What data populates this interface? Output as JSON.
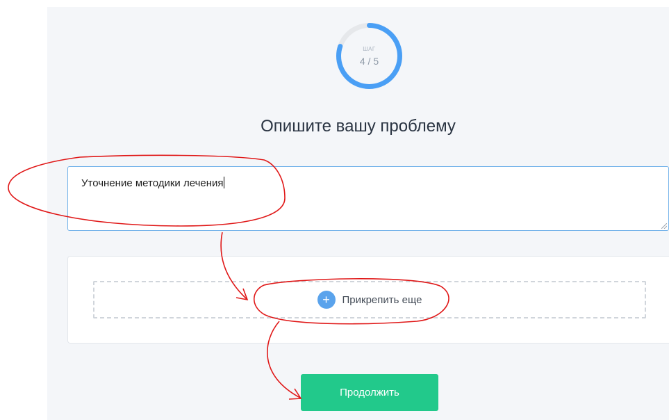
{
  "progress": {
    "step_label": "ШАГ",
    "step_value": "4 / 5",
    "fraction": 0.8,
    "track_color": "#e6e8eb",
    "fill_color": "#4a9ff5"
  },
  "title": "Опишите вашу проблему",
  "problem_field": {
    "value": "Уточнение методики лечения"
  },
  "attach": {
    "label": "Прикрепить еще",
    "icon": "plus-circle-icon"
  },
  "continue_button": {
    "label": "Продолжить",
    "color": "#22c98b"
  },
  "annotation_color": "#e01818"
}
